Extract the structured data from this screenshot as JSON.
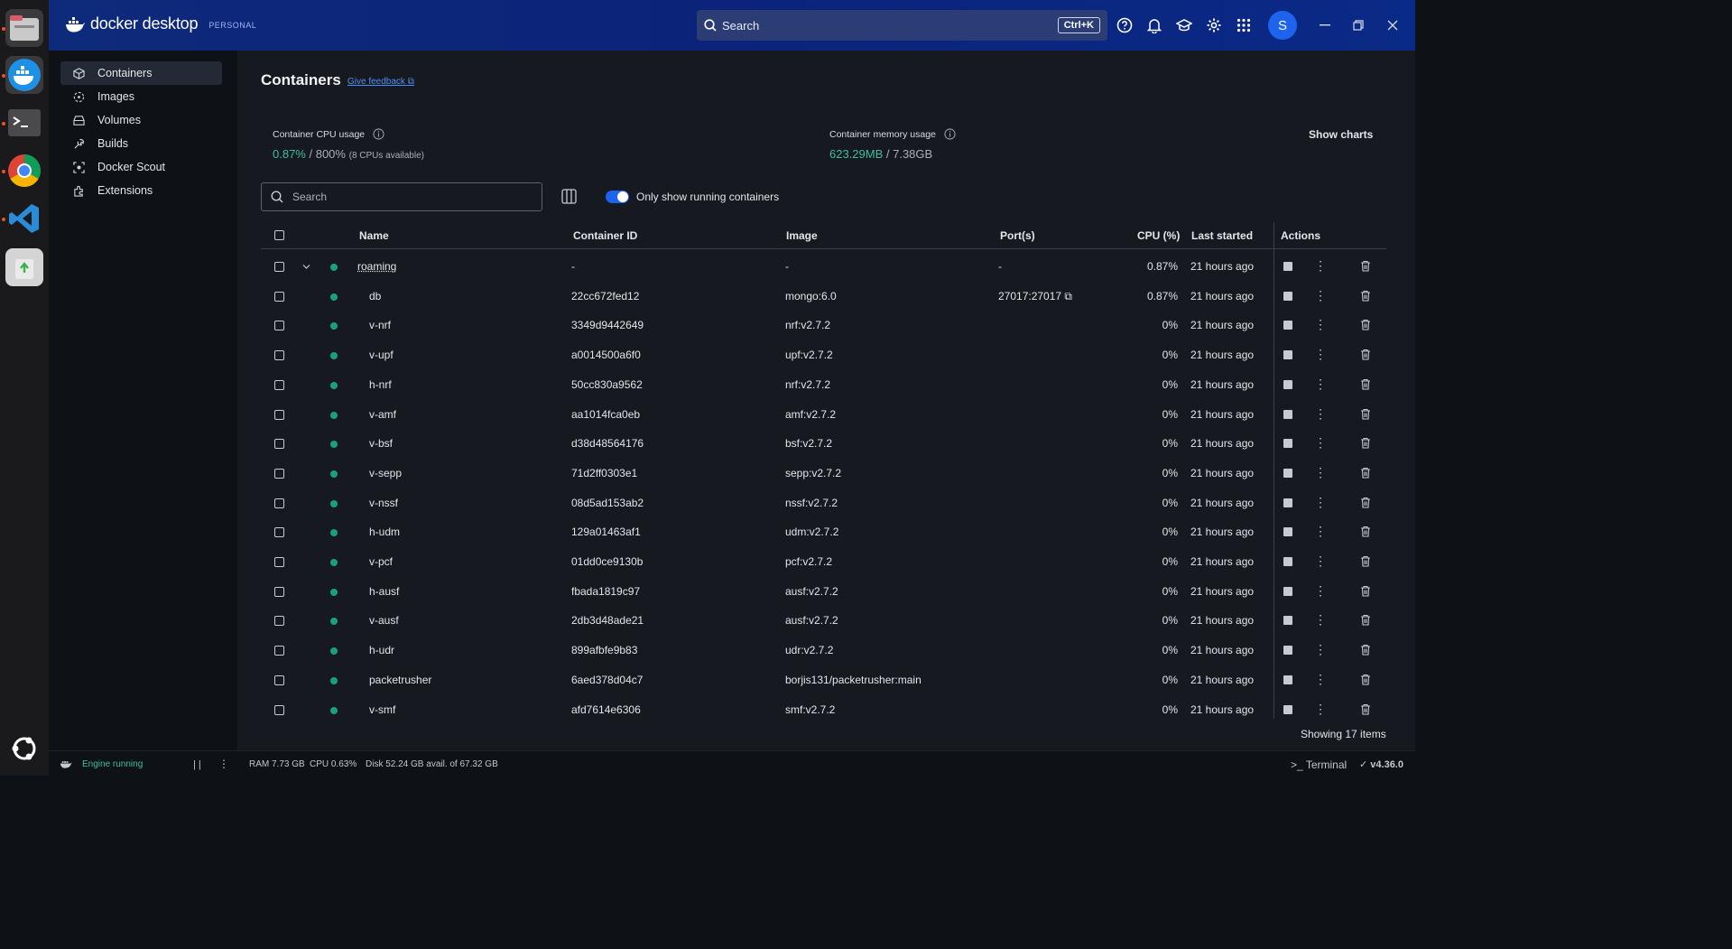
{
  "dock": {
    "apps": [
      "files-icon",
      "docker-icon",
      "terminal-icon",
      "chrome-icon",
      "vscode-icon",
      "trash-icon"
    ]
  },
  "header": {
    "brand": "docker desktop",
    "plan": "PERSONAL",
    "search_placeholder": "Search",
    "shortcut": "Ctrl+K",
    "avatar_initial": "S"
  },
  "sidebar": {
    "items": [
      {
        "label": "Containers",
        "icon": "container-icon",
        "active": true
      },
      {
        "label": "Images",
        "icon": "images-icon",
        "active": false
      },
      {
        "label": "Volumes",
        "icon": "volumes-icon",
        "active": false
      },
      {
        "label": "Builds",
        "icon": "builds-icon",
        "active": false
      },
      {
        "label": "Docker Scout",
        "icon": "scout-icon",
        "active": false
      },
      {
        "label": "Extensions",
        "icon": "extensions-icon",
        "active": false
      }
    ]
  },
  "page": {
    "title": "Containers",
    "feedback": "Give feedback",
    "cpu_label": "Container CPU usage",
    "cpu_value": "0.87%",
    "cpu_total": "/ 800%",
    "cpu_note": "(8 CPUs available)",
    "mem_label": "Container memory usage",
    "mem_value": "623.29MB",
    "mem_total": "/ 7.38GB",
    "show_charts": "Show charts",
    "search_placeholder": "Search",
    "toggle_label": "Only show running containers"
  },
  "table": {
    "headers": {
      "name": "Name",
      "id": "Container ID",
      "image": "Image",
      "ports": "Port(s)",
      "cpu": "CPU (%)",
      "last": "Last started",
      "actions": "Actions"
    },
    "rows": [
      {
        "name": "roaming",
        "id": "-",
        "image": "-",
        "ports": "-",
        "cpu": "0.87%",
        "last": "21 hours ago",
        "group": true
      },
      {
        "name": "db",
        "id": "22cc672fed12",
        "image": "mongo:6.0",
        "ports": "27017:27017",
        "cpu": "0.87%",
        "last": "21 hours ago"
      },
      {
        "name": "v-nrf",
        "id": "3349d9442649",
        "image": "nrf:v2.7.2",
        "ports": "",
        "cpu": "0%",
        "last": "21 hours ago"
      },
      {
        "name": "v-upf",
        "id": "a0014500a6f0",
        "image": "upf:v2.7.2",
        "ports": "",
        "cpu": "0%",
        "last": "21 hours ago"
      },
      {
        "name": "h-nrf",
        "id": "50cc830a9562",
        "image": "nrf:v2.7.2",
        "ports": "",
        "cpu": "0%",
        "last": "21 hours ago"
      },
      {
        "name": "v-amf",
        "id": "aa1014fca0eb",
        "image": "amf:v2.7.2",
        "ports": "",
        "cpu": "0%",
        "last": "21 hours ago"
      },
      {
        "name": "v-bsf",
        "id": "d38d48564176",
        "image": "bsf:v2.7.2",
        "ports": "",
        "cpu": "0%",
        "last": "21 hours ago"
      },
      {
        "name": "v-sepp",
        "id": "71d2ff0303e1",
        "image": "sepp:v2.7.2",
        "ports": "",
        "cpu": "0%",
        "last": "21 hours ago"
      },
      {
        "name": "v-nssf",
        "id": "08d5ad153ab2",
        "image": "nssf:v2.7.2",
        "ports": "",
        "cpu": "0%",
        "last": "21 hours ago"
      },
      {
        "name": "h-udm",
        "id": "129a01463af1",
        "image": "udm:v2.7.2",
        "ports": "",
        "cpu": "0%",
        "last": "21 hours ago"
      },
      {
        "name": "v-pcf",
        "id": "01dd0ce9130b",
        "image": "pcf:v2.7.2",
        "ports": "",
        "cpu": "0%",
        "last": "21 hours ago"
      },
      {
        "name": "h-ausf",
        "id": "fbada1819c97",
        "image": "ausf:v2.7.2",
        "ports": "",
        "cpu": "0%",
        "last": "21 hours ago"
      },
      {
        "name": "v-ausf",
        "id": "2db3d48ade21",
        "image": "ausf:v2.7.2",
        "ports": "",
        "cpu": "0%",
        "last": "21 hours ago"
      },
      {
        "name": "h-udr",
        "id": "899afbfe9b83",
        "image": "udr:v2.7.2",
        "ports": "",
        "cpu": "0%",
        "last": "21 hours ago"
      },
      {
        "name": "packetrusher",
        "id": "6aed378d04c7",
        "image": "borjis131/packetrusher:main",
        "ports": "",
        "cpu": "0%",
        "last": "21 hours ago"
      },
      {
        "name": "v-smf",
        "id": "afd7614e6306",
        "image": "smf:v2.7.2",
        "ports": "",
        "cpu": "0%",
        "last": "21 hours ago"
      }
    ],
    "showing": "Showing 17 items"
  },
  "footer": {
    "engine": "Engine running",
    "ram": "RAM 7.73 GB",
    "cpu": "CPU 0.63%",
    "disk": "Disk 52.24 GB avail. of 67.32 GB",
    "terminal": "Terminal",
    "version": "v4.36.0"
  },
  "colors": {
    "accent": "#1d63ed",
    "running": "#19a17f",
    "header_bg": "#0b237a"
  }
}
